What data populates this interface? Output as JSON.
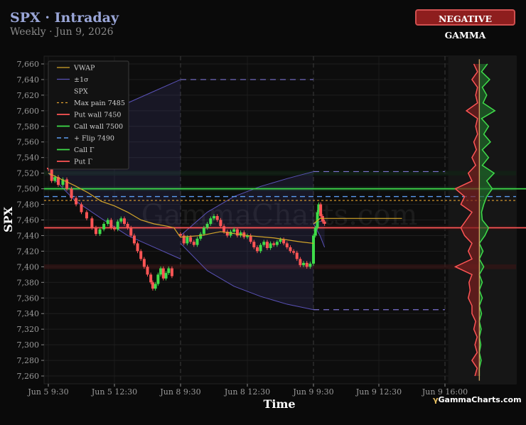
{
  "header": {
    "title": "SPX · Intraday",
    "subtitle": "Weekly · Jun 9, 2026",
    "badge": "NEGATIVE GAMMA"
  },
  "brand": {
    "prefix": "γ",
    "name": "GammaCharts.com"
  },
  "watermark": "GammaCharts.com",
  "colors": {
    "background": "#0a0a0a",
    "vwap": "#d4a62a",
    "sigma": "#5a52b8",
    "put_wall": "#ff5555",
    "call_wall": "#3fdc4a",
    "flip": "#5c9cf0",
    "max_pain": "#e0a030",
    "call_gamma": "#3fdc4a",
    "put_gamma": "#ff5555",
    "candle_up": "#3fdc4a",
    "candle_down": "#ff5555"
  },
  "chart_data": {
    "type": "candlestick",
    "xlabel": "Time",
    "ylabel": "SPX",
    "ylim": [
      7250,
      7670
    ],
    "y_ticks": [
      7260,
      7280,
      7300,
      7320,
      7340,
      7360,
      7380,
      7400,
      7420,
      7440,
      7460,
      7480,
      7500,
      7520,
      7540,
      7560,
      7580,
      7600,
      7620,
      7640,
      7660
    ],
    "x_ticks": [
      {
        "label": "Jun 5 9:30",
        "t": 0
      },
      {
        "label": "Jun 5 12:30",
        "t": 1
      },
      {
        "label": "Jun 8 9:30",
        "t": 2
      },
      {
        "label": "Jun 8 12:30",
        "t": 3
      },
      {
        "label": "Jun 9 9:30",
        "t": 4
      },
      {
        "label": "Jun 9 12:30",
        "t": 5
      },
      {
        "label": "Jun 9 16:00",
        "t": 6
      }
    ],
    "legend": {
      "position": "top-left",
      "entries": [
        {
          "label": "VWAP",
          "style": "vwap"
        },
        {
          "label": "±1σ",
          "style": "sigma"
        },
        {
          "label": "SPX",
          "style": "none"
        },
        {
          "label": "Max pain 7485",
          "style": "maxpain"
        },
        {
          "label": "Put wall 7450",
          "style": "putwall"
        },
        {
          "label": "Call wall 7500",
          "style": "callwall"
        },
        {
          "label": "+ Flip 7490",
          "style": "flip"
        },
        {
          "label": "Call Γ",
          "style": "callgamma"
        },
        {
          "label": "Put Γ",
          "style": "putgamma"
        }
      ]
    },
    "levels": {
      "max_pain": 7485,
      "put_wall": 7450,
      "call_wall": 7500,
      "flip": 7490
    },
    "close_series": [
      {
        "t": 0.0,
        "p": 7525
      },
      {
        "t": 0.05,
        "p": 7510
      },
      {
        "t": 0.1,
        "p": 7515
      },
      {
        "t": 0.15,
        "p": 7505
      },
      {
        "t": 0.22,
        "p": 7512
      },
      {
        "t": 0.28,
        "p": 7500
      },
      {
        "t": 0.35,
        "p": 7488
      },
      {
        "t": 0.42,
        "p": 7480
      },
      {
        "t": 0.5,
        "p": 7470
      },
      {
        "t": 0.58,
        "p": 7462
      },
      {
        "t": 0.66,
        "p": 7450
      },
      {
        "t": 0.72,
        "p": 7442
      },
      {
        "t": 0.78,
        "p": 7448
      },
      {
        "t": 0.84,
        "p": 7455
      },
      {
        "t": 0.9,
        "p": 7460
      },
      {
        "t": 0.95,
        "p": 7450
      },
      {
        "t": 1.0,
        "p": 7448
      },
      {
        "t": 1.05,
        "p": 7458
      },
      {
        "t": 1.1,
        "p": 7462
      },
      {
        "t": 1.15,
        "p": 7455
      },
      {
        "t": 1.2,
        "p": 7450
      },
      {
        "t": 1.25,
        "p": 7440
      },
      {
        "t": 1.3,
        "p": 7430
      },
      {
        "t": 1.35,
        "p": 7420
      },
      {
        "t": 1.4,
        "p": 7410
      },
      {
        "t": 1.45,
        "p": 7400
      },
      {
        "t": 1.5,
        "p": 7390
      },
      {
        "t": 1.55,
        "p": 7380
      },
      {
        "t": 1.58,
        "p": 7372
      },
      {
        "t": 1.62,
        "p": 7378
      },
      {
        "t": 1.66,
        "p": 7390
      },
      {
        "t": 1.7,
        "p": 7398
      },
      {
        "t": 1.74,
        "p": 7385
      },
      {
        "t": 1.78,
        "p": 7392
      },
      {
        "t": 1.82,
        "p": 7398
      },
      {
        "t": 1.87,
        "p": 7388
      },
      {
        "t": 2.0,
        "p": 7440
      },
      {
        "t": 2.05,
        "p": 7430
      },
      {
        "t": 2.1,
        "p": 7438
      },
      {
        "t": 2.15,
        "p": 7432
      },
      {
        "t": 2.2,
        "p": 7428
      },
      {
        "t": 2.25,
        "p": 7436
      },
      {
        "t": 2.3,
        "p": 7442
      },
      {
        "t": 2.35,
        "p": 7450
      },
      {
        "t": 2.4,
        "p": 7455
      },
      {
        "t": 2.45,
        "p": 7462
      },
      {
        "t": 2.5,
        "p": 7465
      },
      {
        "t": 2.55,
        "p": 7460
      },
      {
        "t": 2.6,
        "p": 7452
      },
      {
        "t": 2.65,
        "p": 7445
      },
      {
        "t": 2.7,
        "p": 7440
      },
      {
        "t": 2.75,
        "p": 7445
      },
      {
        "t": 2.8,
        "p": 7448
      },
      {
        "t": 2.85,
        "p": 7440
      },
      {
        "t": 2.9,
        "p": 7444
      },
      {
        "t": 2.95,
        "p": 7438
      },
      {
        "t": 3.0,
        "p": 7440
      },
      {
        "t": 3.05,
        "p": 7432
      },
      {
        "t": 3.1,
        "p": 7425
      },
      {
        "t": 3.15,
        "p": 7420
      },
      {
        "t": 3.2,
        "p": 7428
      },
      {
        "t": 3.25,
        "p": 7432
      },
      {
        "t": 3.3,
        "p": 7424
      },
      {
        "t": 3.35,
        "p": 7430
      },
      {
        "t": 3.4,
        "p": 7428
      },
      {
        "t": 3.45,
        "p": 7432
      },
      {
        "t": 3.5,
        "p": 7435
      },
      {
        "t": 3.55,
        "p": 7430
      },
      {
        "t": 3.6,
        "p": 7425
      },
      {
        "t": 3.65,
        "p": 7420
      },
      {
        "t": 3.7,
        "p": 7418
      },
      {
        "t": 3.75,
        "p": 7410
      },
      {
        "t": 3.8,
        "p": 7402
      },
      {
        "t": 3.85,
        "p": 7405
      },
      {
        "t": 3.9,
        "p": 7400
      },
      {
        "t": 3.95,
        "p": 7404
      },
      {
        "t": 4.0,
        "p": 7440
      },
      {
        "t": 4.03,
        "p": 7450
      },
      {
        "t": 4.06,
        "p": 7470
      },
      {
        "t": 4.08,
        "p": 7480
      },
      {
        "t": 4.11,
        "p": 7465
      },
      {
        "t": 4.14,
        "p": 7458
      },
      {
        "t": 4.17,
        "p": 7455
      }
    ],
    "vwap": [
      {
        "t": 0.0,
        "p": 7520
      },
      {
        "t": 0.2,
        "p": 7512
      },
      {
        "t": 0.4,
        "p": 7504
      },
      {
        "t": 0.6,
        "p": 7495
      },
      {
        "t": 0.8,
        "p": 7484
      },
      {
        "t": 1.0,
        "p": 7478
      },
      {
        "t": 1.2,
        "p": 7470
      },
      {
        "t": 1.4,
        "p": 7460
      },
      {
        "t": 1.6,
        "p": 7455
      },
      {
        "t": 1.8,
        "p": 7452
      },
      {
        "t": 1.9,
        "p": 7450
      },
      {
        "t": 1.98,
        "p": 7440
      },
      {
        "t": 2.0,
        "p": 7438
      },
      {
        "t": 2.3,
        "p": 7440
      },
      {
        "t": 2.6,
        "p": 7445
      },
      {
        "t": 3.0,
        "p": 7440
      },
      {
        "t": 3.4,
        "p": 7437
      },
      {
        "t": 3.8,
        "p": 7432
      },
      {
        "t": 4.0,
        "p": 7430
      },
      {
        "t": 4.0,
        "p": 7455
      },
      {
        "t": 4.1,
        "p": 7462
      },
      {
        "t": 4.17,
        "p": 7462
      },
      {
        "t": 5.0,
        "p": 7462
      },
      {
        "t": 5.35,
        "p": 7462
      }
    ],
    "sigma_upper": [
      {
        "t": 0.0,
        "p": 7528
      },
      {
        "t": 0.4,
        "p": 7565
      },
      {
        "t": 0.8,
        "p": 7590
      },
      {
        "t": 1.2,
        "p": 7610
      },
      {
        "t": 1.6,
        "p": 7625
      },
      {
        "t": 2.0,
        "p": 7640
      },
      {
        "t": 2.0,
        "p": 7440
      },
      {
        "t": 2.4,
        "p": 7470
      },
      {
        "t": 2.8,
        "p": 7490
      },
      {
        "t": 3.2,
        "p": 7503
      },
      {
        "t": 3.6,
        "p": 7513
      },
      {
        "t": 4.0,
        "p": 7522
      },
      {
        "t": 4.0,
        "p": 7455
      },
      {
        "t": 4.1,
        "p": 7458
      },
      {
        "t": 4.17,
        "p": 7460
      }
    ],
    "sigma_lower": [
      {
        "t": 0.0,
        "p": 7520
      },
      {
        "t": 0.4,
        "p": 7485
      },
      {
        "t": 0.8,
        "p": 7462
      },
      {
        "t": 1.2,
        "p": 7440
      },
      {
        "t": 1.6,
        "p": 7425
      },
      {
        "t": 2.0,
        "p": 7410
      },
      {
        "t": 2.0,
        "p": 7430
      },
      {
        "t": 2.4,
        "p": 7395
      },
      {
        "t": 2.8,
        "p": 7375
      },
      {
        "t": 3.2,
        "p": 7362
      },
      {
        "t": 3.6,
        "p": 7352
      },
      {
        "t": 4.0,
        "p": 7345
      },
      {
        "t": 4.0,
        "p": 7455
      },
      {
        "t": 4.1,
        "p": 7440
      },
      {
        "t": 4.17,
        "p": 7425
      }
    ],
    "sigma_projection": [
      {
        "from": 2.0,
        "to": 4.0,
        "p": 7640
      },
      {
        "from": 4.0,
        "to": 6.0,
        "p": 7522
      },
      {
        "from": 4.0,
        "to": 6.0,
        "p": 7345
      }
    ],
    "gamma_profile": {
      "levels": [
        7260,
        7270,
        7280,
        7290,
        7300,
        7310,
        7320,
        7330,
        7340,
        7350,
        7360,
        7370,
        7380,
        7390,
        7400,
        7410,
        7420,
        7430,
        7440,
        7450,
        7460,
        7470,
        7480,
        7490,
        7500,
        7510,
        7520,
        7530,
        7540,
        7550,
        7560,
        7570,
        7580,
        7590,
        7600,
        7610,
        7620,
        7630,
        7640,
        7650,
        7660
      ],
      "call": [
        0,
        0,
        0.5,
        0,
        0.4,
        0,
        0.5,
        0,
        0.6,
        0,
        0.8,
        0,
        0.8,
        0,
        1.2,
        0,
        1.0,
        0,
        1.5,
        2.5,
        0.8,
        0.6,
        1.2,
        2.0,
        3.5,
        2.0,
        4.0,
        0.8,
        2.5,
        0.8,
        3.0,
        1.2,
        2.5,
        0.6,
        4.2,
        1.0,
        2.0,
        0.8,
        2.8,
        0.6,
        2.2
      ],
      "put": [
        1.2,
        0.6,
        2.0,
        0.6,
        1.2,
        0.6,
        1.5,
        1.0,
        2.0,
        2.0,
        3.0,
        2.5,
        2.8,
        2.0,
        6.5,
        2.0,
        3.0,
        2.0,
        4.0,
        5.0,
        3.5,
        2.0,
        5.0,
        4.0,
        6.5,
        2.0,
        3.0,
        1.0,
        2.0,
        0.8,
        1.5,
        0.5,
        1.0,
        0.5,
        3.5,
        0.5,
        1.0,
        0.5,
        2.0,
        0.5,
        1.5
      ]
    }
  }
}
